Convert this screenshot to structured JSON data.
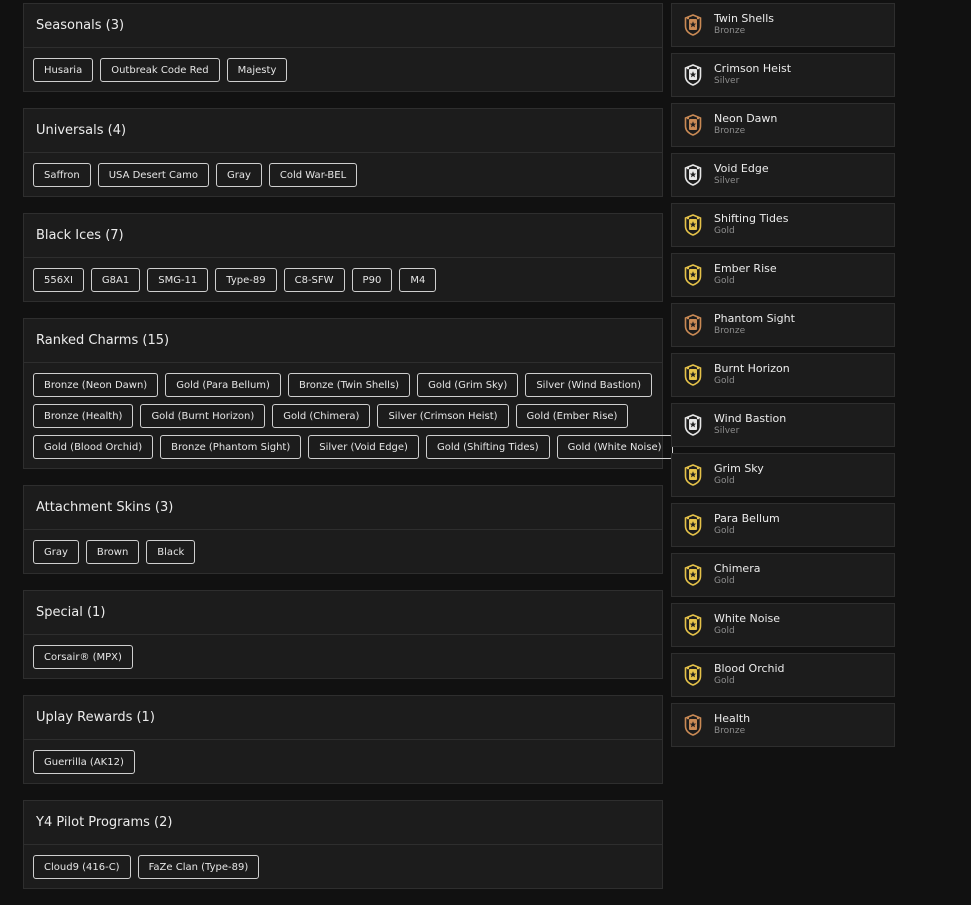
{
  "sections": [
    {
      "title": "Seasonals (3)",
      "rows": [
        [
          "Husaria",
          "Outbreak Code Red",
          "Majesty"
        ]
      ]
    },
    {
      "title": "Universals (4)",
      "rows": [
        [
          "Saffron",
          "USA Desert Camo",
          "Gray",
          "Cold War-BEL"
        ]
      ]
    },
    {
      "title": "Black Ices (7)",
      "rows": [
        [
          "556XI",
          "G8A1",
          "SMG-11",
          "Type-89",
          "C8-SFW",
          "P90",
          "M4"
        ]
      ]
    },
    {
      "title": "Ranked Charms (15)",
      "rows": [
        [
          "Bronze (Neon Dawn)",
          "Gold (Para Bellum)",
          "Bronze (Twin Shells)",
          "Gold (Grim Sky)",
          "Silver (Wind Bastion)"
        ],
        [
          "Bronze (Health)",
          "Gold (Burnt Horizon)",
          "Gold (Chimera)",
          "Silver (Crimson Heist)",
          "Gold (Ember Rise)"
        ],
        [
          "Gold (Blood Orchid)",
          "Bronze (Phantom Sight)",
          "Silver (Void Edge)",
          "Gold (Shifting Tides)",
          "Gold (White Noise)"
        ]
      ]
    },
    {
      "title": "Attachment Skins (3)",
      "rows": [
        [
          "Gray",
          "Brown",
          "Black"
        ]
      ]
    },
    {
      "title": "Special (1)",
      "rows": [
        [
          "Corsair® (MPX)"
        ]
      ]
    },
    {
      "title": "Uplay Rewards (1)",
      "rows": [
        [
          "Guerrilla (AK12)"
        ]
      ]
    },
    {
      "title": "Y4 Pilot Programs (2)",
      "rows": [
        [
          "Cloud9 (416-C)",
          "FaZe Clan (Type-89)"
        ]
      ]
    }
  ],
  "charms": [
    {
      "name": "Twin Shells",
      "tier": "Bronze"
    },
    {
      "name": "Crimson Heist",
      "tier": "Silver"
    },
    {
      "name": "Neon Dawn",
      "tier": "Bronze"
    },
    {
      "name": "Void Edge",
      "tier": "Silver"
    },
    {
      "name": "Shifting Tides",
      "tier": "Gold"
    },
    {
      "name": "Ember Rise",
      "tier": "Gold"
    },
    {
      "name": "Phantom Sight",
      "tier": "Bronze"
    },
    {
      "name": "Burnt Horizon",
      "tier": "Gold"
    },
    {
      "name": "Wind Bastion",
      "tier": "Silver"
    },
    {
      "name": "Grim Sky",
      "tier": "Gold"
    },
    {
      "name": "Para Bellum",
      "tier": "Gold"
    },
    {
      "name": "Chimera",
      "tier": "Gold"
    },
    {
      "name": "White Noise",
      "tier": "Gold"
    },
    {
      "name": "Blood Orchid",
      "tier": "Gold"
    },
    {
      "name": "Health",
      "tier": "Bronze"
    }
  ],
  "tier_colors": {
    "Bronze": "#c98a55",
    "Silver": "#e6e6e6",
    "Gold": "#e5c24a"
  },
  "icon_name": "rank-badge-icon"
}
